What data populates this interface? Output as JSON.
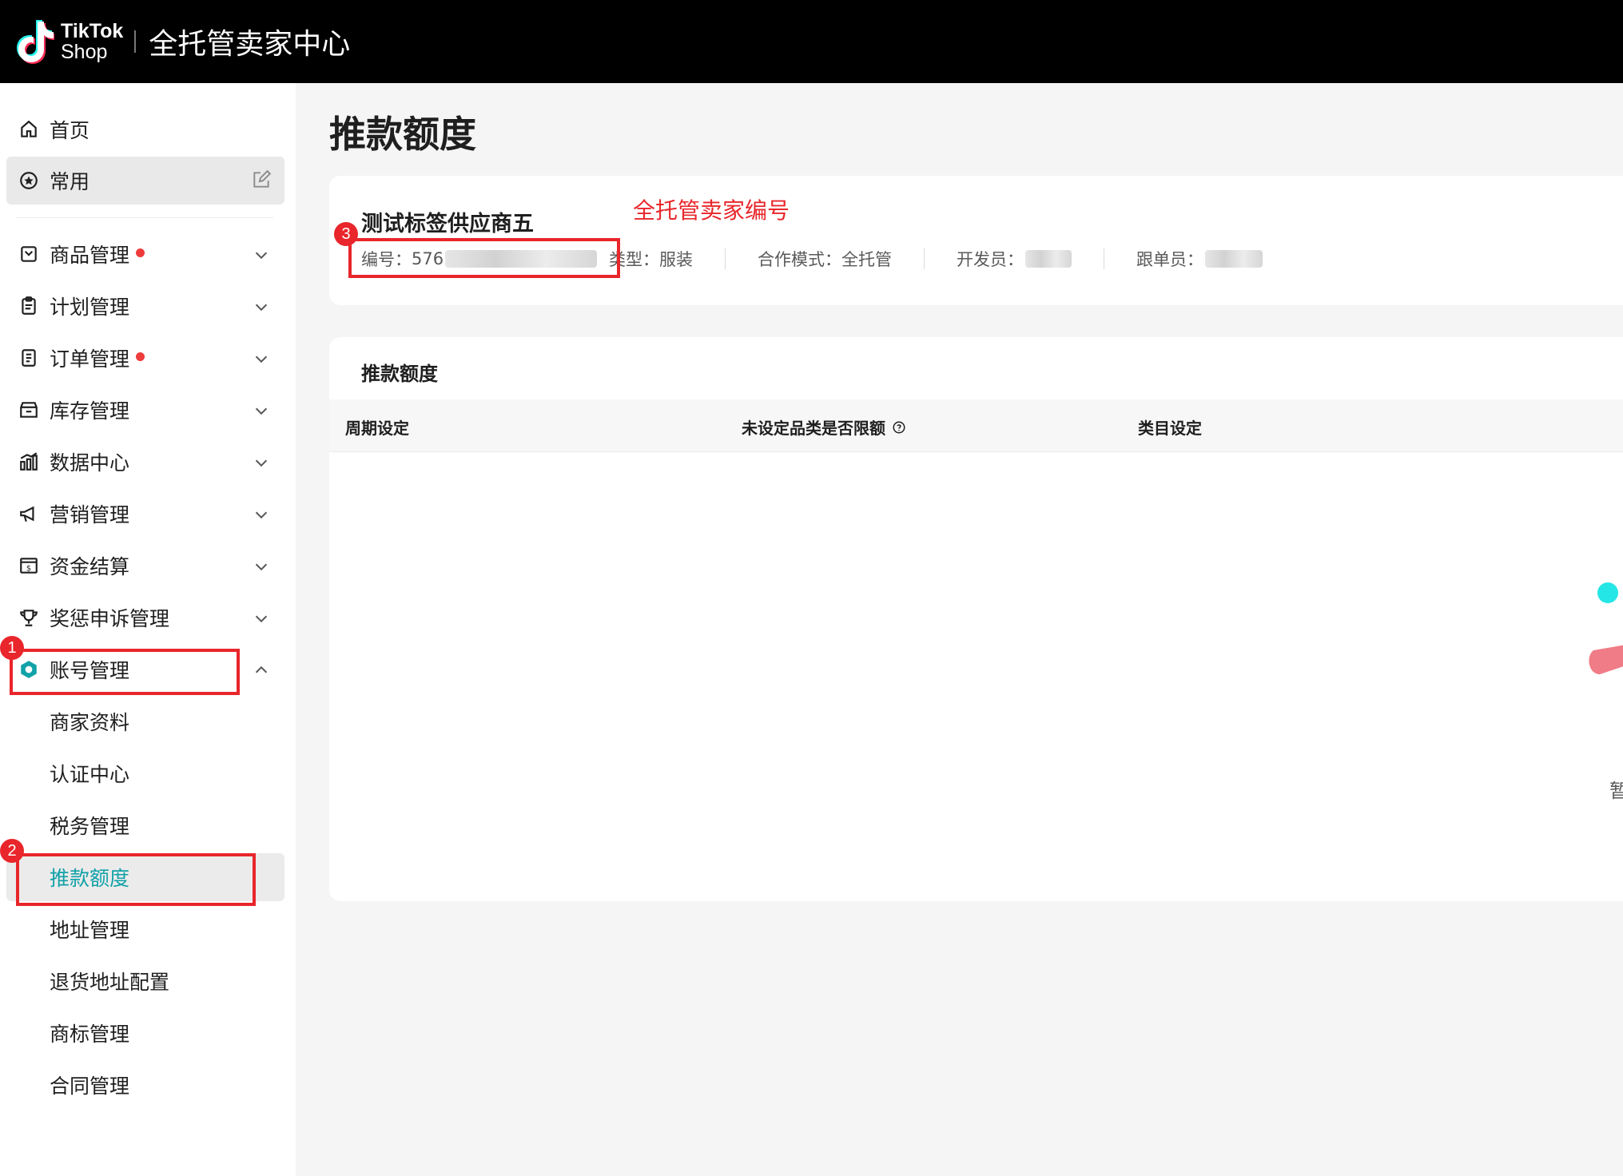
{
  "header": {
    "logo_line1": "TikTok",
    "logo_line2": "Shop",
    "app_title": "全托管卖家中心"
  },
  "sidebar": {
    "items": [
      {
        "label": "首页",
        "icon": "home-icon"
      },
      {
        "label": "常用",
        "icon": "star-circle-icon"
      },
      {
        "label": "商品管理",
        "icon": "box-icon",
        "badge": true
      },
      {
        "label": "计划管理",
        "icon": "clipboard-icon"
      },
      {
        "label": "订单管理",
        "icon": "document-icon",
        "badge": true
      },
      {
        "label": "库存管理",
        "icon": "warehouse-icon"
      },
      {
        "label": "数据中心",
        "icon": "bar-chart-icon"
      },
      {
        "label": "营销管理",
        "icon": "megaphone-icon"
      },
      {
        "label": "资金结算",
        "icon": "money-icon"
      },
      {
        "label": "奖惩申诉管理",
        "icon": "trophy-icon"
      },
      {
        "label": "账号管理",
        "icon": "hexagon-gear-icon",
        "expanded": true
      }
    ],
    "sub_items": [
      {
        "label": "商家资料"
      },
      {
        "label": "认证中心"
      },
      {
        "label": "税务管理"
      },
      {
        "label": "推款额度",
        "selected": true
      },
      {
        "label": "地址管理"
      },
      {
        "label": "退货地址配置"
      },
      {
        "label": "商标管理"
      },
      {
        "label": "合同管理"
      }
    ]
  },
  "annotations": {
    "badge1": "1",
    "badge2": "2",
    "badge3": "3",
    "label3": "全托管卖家编号"
  },
  "main": {
    "page_title": "推款额度",
    "info_card": {
      "supplier_name": "测试标签供应商五",
      "id_label": "编号：",
      "id_value": "576",
      "type_label": "类型：",
      "type_value": "服装",
      "mode_label": "合作模式：",
      "mode_value": "全托管",
      "developer_label": "开发员：",
      "follower_label": "跟单员："
    },
    "table_card": {
      "title": "推款额度",
      "columns": [
        "周期设定",
        "未设定品类是否限额",
        "类目设定"
      ],
      "empty_text": "暂"
    }
  },
  "colors": {
    "header_bg": "#000000",
    "accent": "#11a1a8",
    "annotation_red": "#e8262b",
    "badge_red": "#ee3b3b"
  }
}
